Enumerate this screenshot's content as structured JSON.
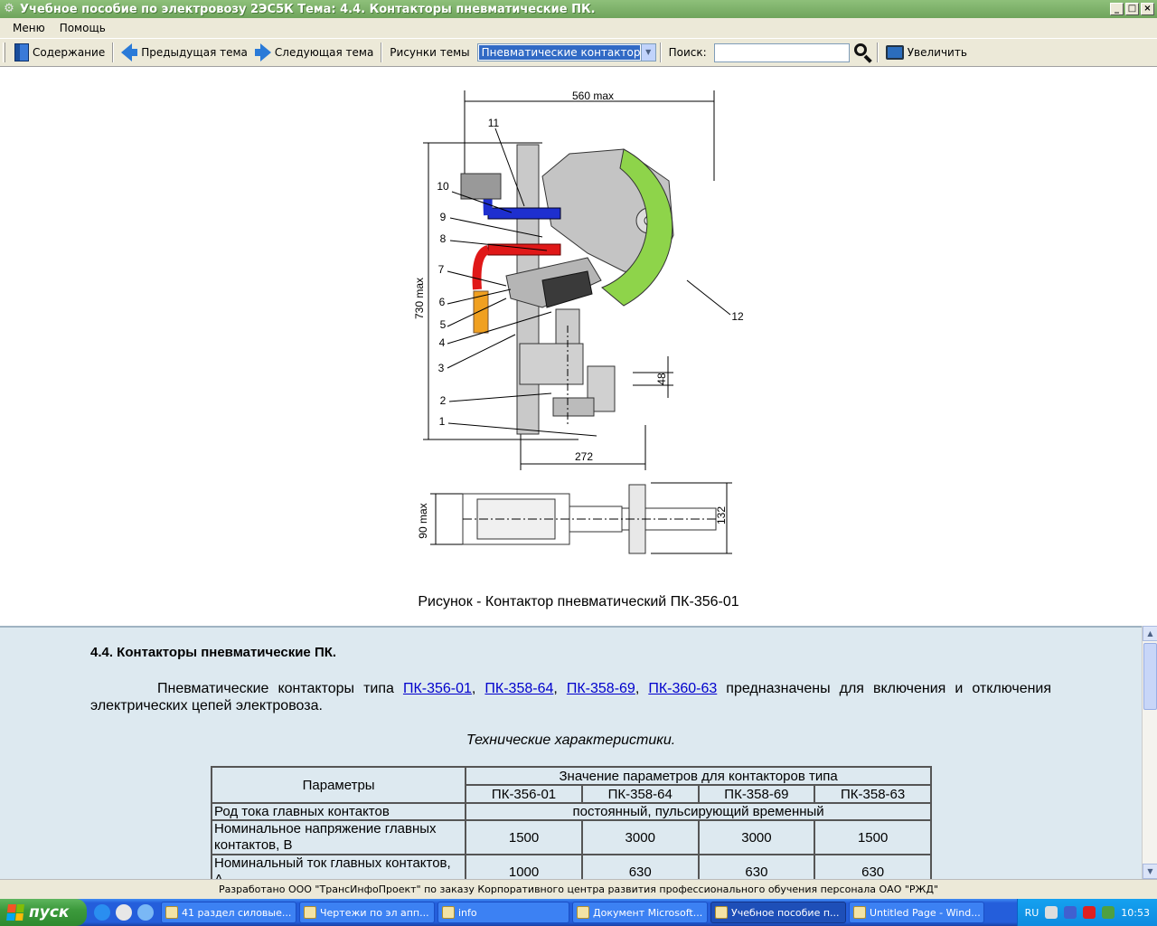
{
  "window": {
    "title": "Учебное пособие по электровозу 2ЭС5К Тема: 4.4. Контакторы пневматические ПК.",
    "buttons": {
      "minimize": "_",
      "maximize": "□",
      "close": "×"
    }
  },
  "menu": [
    "Меню",
    "Помощь"
  ],
  "toolbar": {
    "contents": "Содержание",
    "prev": "Предыдущая тема",
    "next": "Следующая тема",
    "pictures_label": "Рисунки темы",
    "pictures_selected": "Пневматические контакторы",
    "search_label": "Поиск:",
    "search_value": "",
    "zoom": "Увеличить"
  },
  "figure": {
    "caption": "Рисунок - Контактор пневматический ПК-356-01",
    "dimensions": [
      "560 max",
      "730 max",
      "272",
      "48",
      "90 max",
      "132"
    ],
    "callouts": [
      "11",
      "10",
      "9",
      "8",
      "7",
      "6",
      "5",
      "4",
      "3",
      "2",
      "1",
      "12"
    ]
  },
  "content": {
    "heading": "4.4. Контакторы пневматические ПК.",
    "intro_before": "Пневматические контакторы типа ",
    "links": [
      "ПК-356-01",
      "ПК-358-64",
      "ПК-358-69",
      "ПК-360-63"
    ],
    "intro_after": " предназначены для включения и отключения электрических цепей электровоза.",
    "specs_title": "Технические характеристики.",
    "table": {
      "param_header": "Параметры",
      "group_header": "Значение параметров для контакторов типа",
      "types": [
        "ПК-356-01",
        "ПК-358-64",
        "ПК-358-69",
        "ПК-358-63"
      ],
      "rows": [
        {
          "label": "Род тока главных контактов",
          "merged": "постоянный, пульсирующий временный"
        },
        {
          "label": "Номинальное напряжение главных контактов, В",
          "values": [
            "1500",
            "3000",
            "3000",
            "1500"
          ]
        },
        {
          "label": "Номинальный ток главных контактов, А",
          "values": [
            "1000",
            "630",
            "630",
            "630"
          ]
        }
      ]
    }
  },
  "footer": "Разработано ООО \"ТрансИнфоПроект\" по заказу Корпоративного центра развития профессионального обучения персонала ОАО \"РЖД\"",
  "taskbar": {
    "start": "пуск",
    "tasks": [
      "41 раздел силовые...",
      "Чертежи по эл апп...",
      "info",
      "Документ Microsoft...",
      "Учебное пособие п...",
      "Untitled Page - Wind..."
    ],
    "lang": "RU",
    "clock": "10:53"
  },
  "colors": {
    "titlebar": "#7bb068",
    "panel": "#dde9f0",
    "taskbar": "#245edb",
    "link": "#0000cc"
  }
}
